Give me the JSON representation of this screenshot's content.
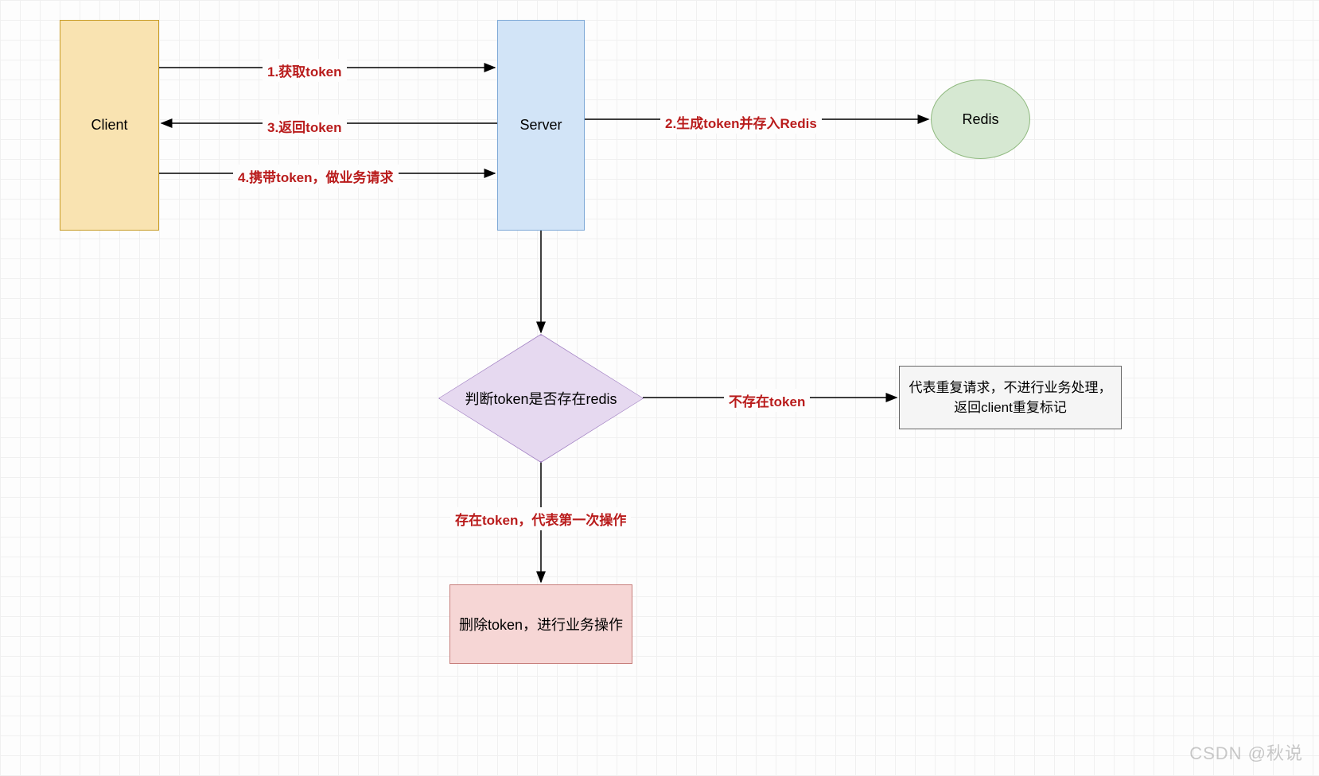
{
  "nodes": {
    "client": "Client",
    "server": "Server",
    "redis": "Redis",
    "decision": "判断token是否存在redis",
    "result": "代表重复请求，不进行业务处理，返回client重复标记",
    "action": "删除token，进行业务操作"
  },
  "edges": {
    "e1": "1.获取token",
    "e2": "2.生成token并存入Redis",
    "e3": "3.返回token",
    "e4": "4.携带token，做业务请求",
    "e5": "不存在token",
    "e6": "存在token，代表第一次操作"
  },
  "watermark": "CSDN @秋说"
}
